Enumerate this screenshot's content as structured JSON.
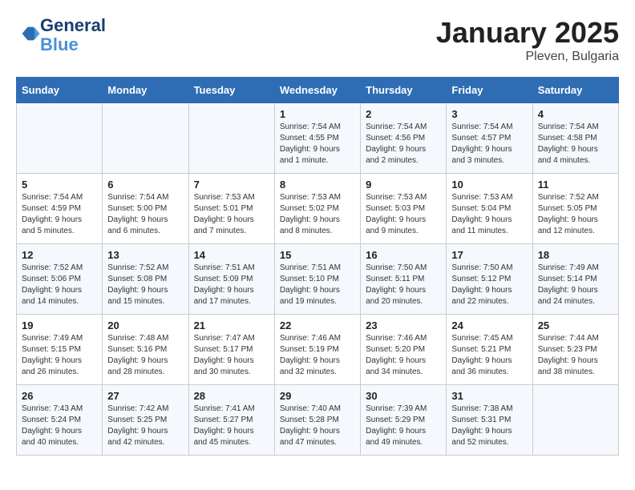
{
  "logo": {
    "line1": "General",
    "line2": "Blue"
  },
  "title": "January 2025",
  "subtitle": "Pleven, Bulgaria",
  "headers": [
    "Sunday",
    "Monday",
    "Tuesday",
    "Wednesday",
    "Thursday",
    "Friday",
    "Saturday"
  ],
  "weeks": [
    [
      {
        "day": "",
        "text": ""
      },
      {
        "day": "",
        "text": ""
      },
      {
        "day": "",
        "text": ""
      },
      {
        "day": "1",
        "text": "Sunrise: 7:54 AM\nSunset: 4:55 PM\nDaylight: 9 hours\nand 1 minute."
      },
      {
        "day": "2",
        "text": "Sunrise: 7:54 AM\nSunset: 4:56 PM\nDaylight: 9 hours\nand 2 minutes."
      },
      {
        "day": "3",
        "text": "Sunrise: 7:54 AM\nSunset: 4:57 PM\nDaylight: 9 hours\nand 3 minutes."
      },
      {
        "day": "4",
        "text": "Sunrise: 7:54 AM\nSunset: 4:58 PM\nDaylight: 9 hours\nand 4 minutes."
      }
    ],
    [
      {
        "day": "5",
        "text": "Sunrise: 7:54 AM\nSunset: 4:59 PM\nDaylight: 9 hours\nand 5 minutes."
      },
      {
        "day": "6",
        "text": "Sunrise: 7:54 AM\nSunset: 5:00 PM\nDaylight: 9 hours\nand 6 minutes."
      },
      {
        "day": "7",
        "text": "Sunrise: 7:53 AM\nSunset: 5:01 PM\nDaylight: 9 hours\nand 7 minutes."
      },
      {
        "day": "8",
        "text": "Sunrise: 7:53 AM\nSunset: 5:02 PM\nDaylight: 9 hours\nand 8 minutes."
      },
      {
        "day": "9",
        "text": "Sunrise: 7:53 AM\nSunset: 5:03 PM\nDaylight: 9 hours\nand 9 minutes."
      },
      {
        "day": "10",
        "text": "Sunrise: 7:53 AM\nSunset: 5:04 PM\nDaylight: 9 hours\nand 11 minutes."
      },
      {
        "day": "11",
        "text": "Sunrise: 7:52 AM\nSunset: 5:05 PM\nDaylight: 9 hours\nand 12 minutes."
      }
    ],
    [
      {
        "day": "12",
        "text": "Sunrise: 7:52 AM\nSunset: 5:06 PM\nDaylight: 9 hours\nand 14 minutes."
      },
      {
        "day": "13",
        "text": "Sunrise: 7:52 AM\nSunset: 5:08 PM\nDaylight: 9 hours\nand 15 minutes."
      },
      {
        "day": "14",
        "text": "Sunrise: 7:51 AM\nSunset: 5:09 PM\nDaylight: 9 hours\nand 17 minutes."
      },
      {
        "day": "15",
        "text": "Sunrise: 7:51 AM\nSunset: 5:10 PM\nDaylight: 9 hours\nand 19 minutes."
      },
      {
        "day": "16",
        "text": "Sunrise: 7:50 AM\nSunset: 5:11 PM\nDaylight: 9 hours\nand 20 minutes."
      },
      {
        "day": "17",
        "text": "Sunrise: 7:50 AM\nSunset: 5:12 PM\nDaylight: 9 hours\nand 22 minutes."
      },
      {
        "day": "18",
        "text": "Sunrise: 7:49 AM\nSunset: 5:14 PM\nDaylight: 9 hours\nand 24 minutes."
      }
    ],
    [
      {
        "day": "19",
        "text": "Sunrise: 7:49 AM\nSunset: 5:15 PM\nDaylight: 9 hours\nand 26 minutes."
      },
      {
        "day": "20",
        "text": "Sunrise: 7:48 AM\nSunset: 5:16 PM\nDaylight: 9 hours\nand 28 minutes."
      },
      {
        "day": "21",
        "text": "Sunrise: 7:47 AM\nSunset: 5:17 PM\nDaylight: 9 hours\nand 30 minutes."
      },
      {
        "day": "22",
        "text": "Sunrise: 7:46 AM\nSunset: 5:19 PM\nDaylight: 9 hours\nand 32 minutes."
      },
      {
        "day": "23",
        "text": "Sunrise: 7:46 AM\nSunset: 5:20 PM\nDaylight: 9 hours\nand 34 minutes."
      },
      {
        "day": "24",
        "text": "Sunrise: 7:45 AM\nSunset: 5:21 PM\nDaylight: 9 hours\nand 36 minutes."
      },
      {
        "day": "25",
        "text": "Sunrise: 7:44 AM\nSunset: 5:23 PM\nDaylight: 9 hours\nand 38 minutes."
      }
    ],
    [
      {
        "day": "26",
        "text": "Sunrise: 7:43 AM\nSunset: 5:24 PM\nDaylight: 9 hours\nand 40 minutes."
      },
      {
        "day": "27",
        "text": "Sunrise: 7:42 AM\nSunset: 5:25 PM\nDaylight: 9 hours\nand 42 minutes."
      },
      {
        "day": "28",
        "text": "Sunrise: 7:41 AM\nSunset: 5:27 PM\nDaylight: 9 hours\nand 45 minutes."
      },
      {
        "day": "29",
        "text": "Sunrise: 7:40 AM\nSunset: 5:28 PM\nDaylight: 9 hours\nand 47 minutes."
      },
      {
        "day": "30",
        "text": "Sunrise: 7:39 AM\nSunset: 5:29 PM\nDaylight: 9 hours\nand 49 minutes."
      },
      {
        "day": "31",
        "text": "Sunrise: 7:38 AM\nSunset: 5:31 PM\nDaylight: 9 hours\nand 52 minutes."
      },
      {
        "day": "",
        "text": ""
      }
    ]
  ]
}
